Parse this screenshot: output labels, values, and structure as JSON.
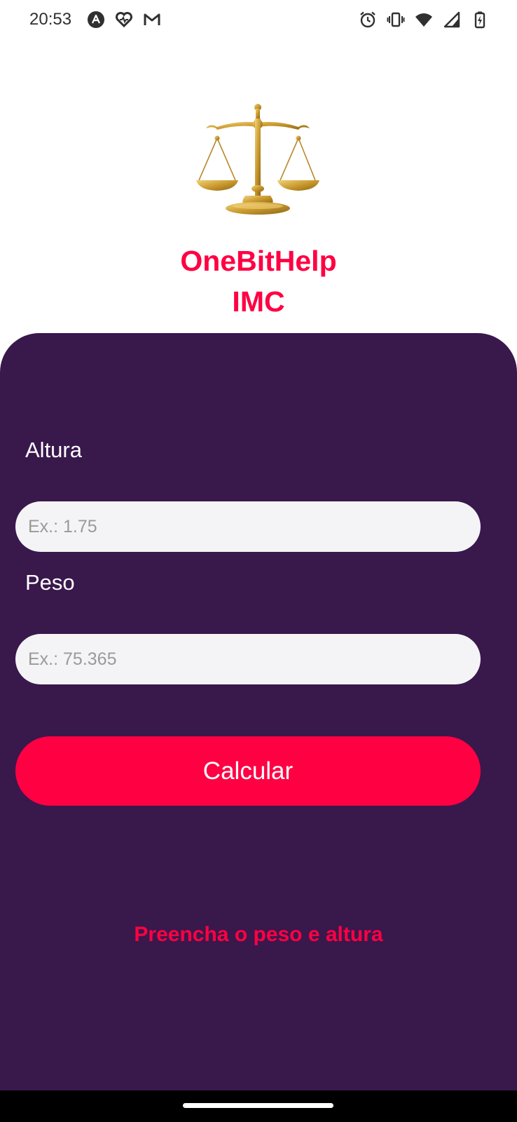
{
  "status_bar": {
    "time": "20:53",
    "left_icons": [
      "app-notification-icon",
      "health-app-icon",
      "gmail-icon"
    ],
    "right_icons": [
      "alarm-icon",
      "vibrate-icon",
      "wifi-icon",
      "signal-icon",
      "battery-charging-icon"
    ]
  },
  "header": {
    "logo_icon": "scales-of-justice-icon",
    "title_line1": "OneBitHelp",
    "title_line2": "IMC"
  },
  "form": {
    "height_label": "Altura",
    "height_value": "",
    "height_placeholder": "Ex.: 1.75",
    "weight_label": "Peso",
    "weight_value": "",
    "weight_placeholder": "Ex.: 75.365",
    "calculate_label": "Calcular",
    "message": "Preencha o peso e altura"
  },
  "colors": {
    "accent": "#ff0043",
    "panel": "#39184c",
    "input_bg": "#f4f4f6",
    "logo_gold": "#c99a2e"
  }
}
